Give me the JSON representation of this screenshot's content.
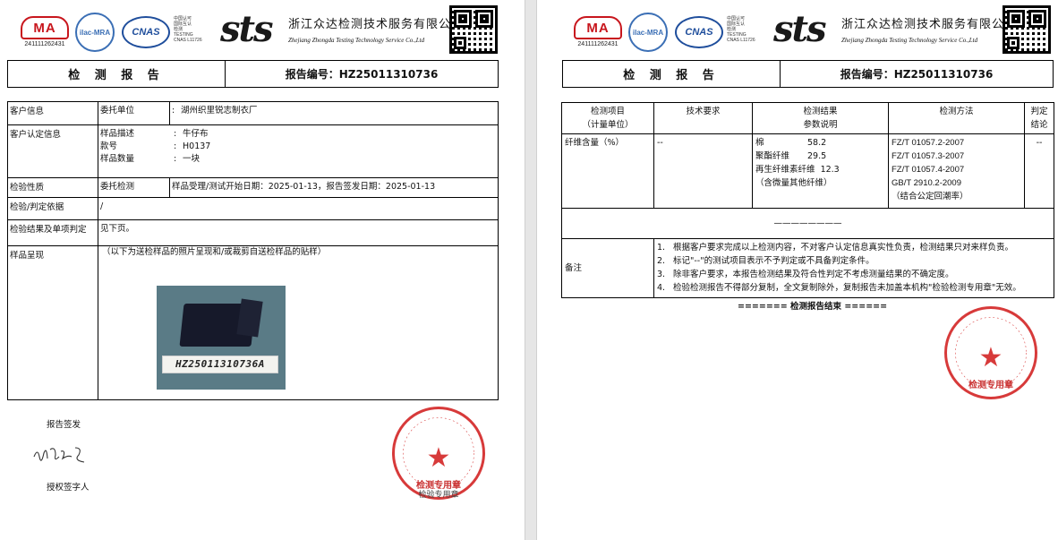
{
  "header": {
    "ma_logo": "MA",
    "ma_number": "241111262431",
    "ilac_logo": "ilac-MRA",
    "cnas_logo": "CNAS",
    "cnas_text_lines": [
      "中国认可",
      "国际互认",
      "检测",
      "TESTING",
      "CNAS L11726"
    ],
    "sts_logo": "sts",
    "company_cn": "浙江众达检测技术服务有限公司",
    "company_en": "Zhejiang Zhongda Testing Technology Service Co.,Ltd"
  },
  "left_page": {
    "title": "检 测 报 告",
    "report_no": "报告编号：HZ25011310736",
    "rows": {
      "client_label": "客户信息",
      "client_field": "委托单位",
      "client_value": "湖州织里锐志制衣厂",
      "confirm_label": "客户认定信息",
      "sample_desc_k": "样品描述",
      "sample_desc_v": "牛仔布",
      "style_k": "款号",
      "style_v": "H0137",
      "qty_k": "样品数量",
      "qty_v": "一块",
      "nature_label": "检验性质",
      "nature_value": "委托检测",
      "dates_value": "样品受理/测试开始日期：2025-01-13，报告签发日期：2025-01-13",
      "basis_label": "检验/判定依据",
      "basis_value": "/",
      "result_label": "检验结果及单项判定",
      "result_value": "见下页。",
      "photo_label": "样品呈现",
      "photo_caption": "（以下为送检样品的照片呈现和/或裁剪自送检样品的贴样）",
      "photo_tag": "HZ25011310736A"
    },
    "sign_label": "报告签发",
    "authorized_label": "授权签字人",
    "stamp_name": "检测专用章",
    "stamp_company": "浙江众达检测技术服务有限公司",
    "stamp_overlap_text": "检验专用章"
  },
  "right_page": {
    "title": "检 测 报 告",
    "report_no": "报告编号：HZ25011310736",
    "table_headers": {
      "item": "检测项目",
      "item_sub": "（计量单位）",
      "requirement": "技术要求",
      "result": "检测结果",
      "result_sub": "参数说明",
      "method": "检测方法",
      "judgement": "判定",
      "judgement_sub": "结论"
    },
    "row": {
      "item": "纤维含量（%）",
      "requirement": "--",
      "fibers": [
        {
          "name": "棉",
          "value": "58.2"
        },
        {
          "name": "聚酯纤维",
          "value": "29.5"
        },
        {
          "name": "再生纤维素纤维",
          "value": "12.3"
        }
      ],
      "fiber_note": "（含微量其他纤维）",
      "methods": [
        "FZ/T 01057.2-2007",
        "FZ/T 01057.3-2007",
        "FZ/T 01057.4-2007",
        "GB/T 2910.2-2009",
        "（结合公定回潮率）"
      ],
      "judgement": "--"
    },
    "blank_line": "————————",
    "notes_label": "备注",
    "notes": [
      {
        "n": "1.",
        "text": "根据客户要求完成以上检测内容，不对客户认定信息真实性负责，检测结果只对来样负责。"
      },
      {
        "n": "2.",
        "text": "标记\"--\"的测试项目表示不予判定或不具备判定条件。"
      },
      {
        "n": "3.",
        "text": "除非客户要求，本报告检测结果及符合性判定不考虑测量结果的不确定度。"
      },
      {
        "n": "4.",
        "text": "检验检测报告不得部分复制，全文复制除外，复制报告未加盖本机构\"检验检测专用章\"无效。"
      }
    ],
    "end_text": "======= 检测报告结束 ======",
    "stamp_name": "检测专用章",
    "stamp_company": "浙江众达检测技术服务有限公司"
  },
  "colors": {
    "stamp_red": "#d42a2a",
    "ma_red": "#c8161d",
    "cnas_blue": "#1f4e9c"
  }
}
